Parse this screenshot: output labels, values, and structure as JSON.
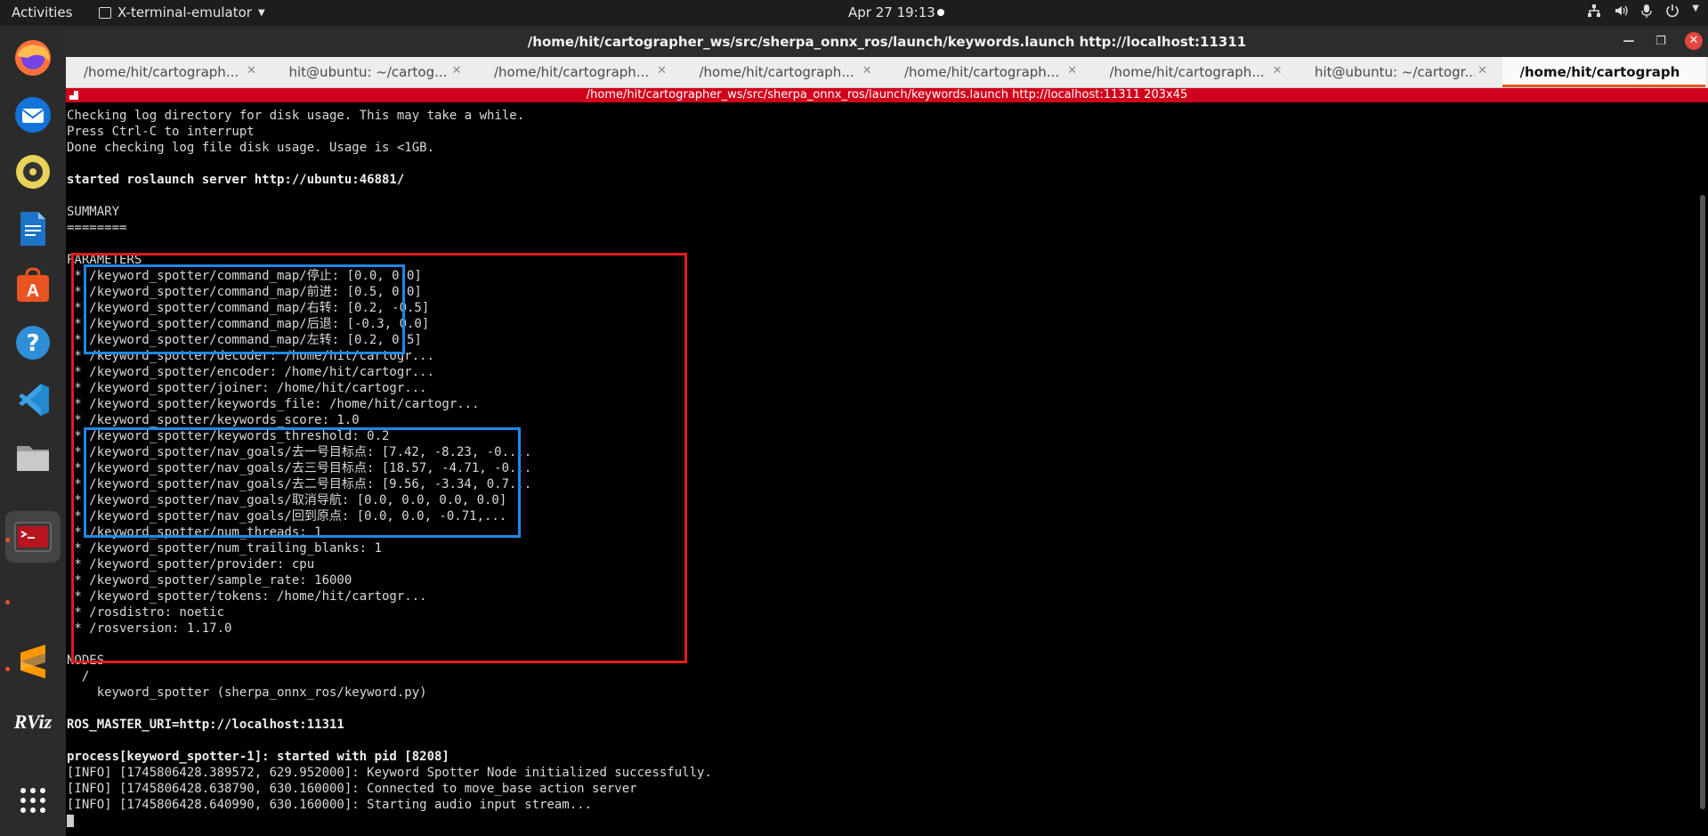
{
  "topbar": {
    "activities": "Activities",
    "app_name": "X-terminal-emulator",
    "clock": "Apr 27  19:13",
    "tray_icons": [
      "network-icon",
      "volume-icon",
      "microphone-icon",
      "power-icon"
    ]
  },
  "dock": {
    "items": [
      "firefox-icon",
      "thunderbird-icon",
      "rhythmbox-icon",
      "libreoffice-writer-icon",
      "ubuntu-software-icon",
      "help-icon",
      "vscode-icon",
      "files-icon",
      "terminal-icon",
      "sublime-icon",
      "rviz-icon",
      "app-grid-icon"
    ],
    "rviz_label": "RViz"
  },
  "window": {
    "title": "/home/hit/cartographer_ws/src/sherpa_onnx_ros/launch/keywords.launch http://localhost:11311",
    "tabs": [
      {
        "label": "/home/hit/cartograph..."
      },
      {
        "label": "hit@ubuntu: ~/cartog..."
      },
      {
        "label": "/home/hit/cartograph..."
      },
      {
        "label": "/home/hit/cartograph..."
      },
      {
        "label": "/home/hit/cartograph..."
      },
      {
        "label": "/home/hit/cartograph..."
      },
      {
        "label": "hit@ubuntu: ~/cartogr..."
      },
      {
        "label": "/home/hit/cartograph..."
      }
    ],
    "active_tab": 7,
    "status_bar": "/home/hit/cartographer_ws/src/sherpa_onnx_ros/launch/keywords.launch http://localhost:11311 203x45"
  },
  "terminal": {
    "lines": [
      "Checking log directory for disk usage. This may take a while.",
      "Press Ctrl-C to interrupt",
      "Done checking log file disk usage. Usage is <1GB.",
      "",
      "started roslaunch server http://ubuntu:46881/",
      "",
      "SUMMARY",
      "========",
      "",
      "PARAMETERS",
      " * /keyword_spotter/command_map/停止: [0.0, 0.0]",
      " * /keyword_spotter/command_map/前进: [0.5, 0.0]",
      " * /keyword_spotter/command_map/右转: [0.2, -0.5]",
      " * /keyword_spotter/command_map/后退: [-0.3, 0.0]",
      " * /keyword_spotter/command_map/左转: [0.2, 0.5]",
      " * /keyword_spotter/decoder: /home/hit/cartogr...",
      " * /keyword_spotter/encoder: /home/hit/cartogr...",
      " * /keyword_spotter/joiner: /home/hit/cartogr...",
      " * /keyword_spotter/keywords_file: /home/hit/cartogr...",
      " * /keyword_spotter/keywords_score: 1.0",
      " * /keyword_spotter/keywords_threshold: 0.2",
      " * /keyword_spotter/nav_goals/去一号目标点: [7.42, -8.23, -0....",
      " * /keyword_spotter/nav_goals/去三号目标点: [18.57, -4.71, -0...",
      " * /keyword_spotter/nav_goals/去二号目标点: [9.56, -3.34, 0.7...",
      " * /keyword_spotter/nav_goals/取消导航: [0.0, 0.0, 0.0, 0.0]",
      " * /keyword_spotter/nav_goals/回到原点: [0.0, 0.0, -0.71,...",
      " * /keyword_spotter/num_threads: 1",
      " * /keyword_spotter/num_trailing_blanks: 1",
      " * /keyword_spotter/provider: cpu",
      " * /keyword_spotter/sample_rate: 16000",
      " * /keyword_spotter/tokens: /home/hit/cartogr...",
      " * /rosdistro: noetic",
      " * /rosversion: 1.17.0",
      "",
      "NODES",
      "  /",
      "    keyword_spotter (sherpa_onnx_ros/keyword.py)",
      "",
      "ROS_MASTER_URI=http://localhost:11311",
      "",
      "process[keyword_spotter-1]: started with pid [8208]",
      "[INFO] [1745806428.389572, 629.952000]: Keyword Spotter Node initialized successfully.",
      "[INFO] [1745806428.638790, 630.160000]: Connected to move_base action server",
      "[INFO] [1745806428.640990, 630.160000]: Starting audio input stream..."
    ],
    "bold_lines": [
      4,
      38,
      40
    ]
  },
  "annotation_colors": {
    "red_box": "#e51b1b",
    "blue_box": "#1e88e5"
  }
}
